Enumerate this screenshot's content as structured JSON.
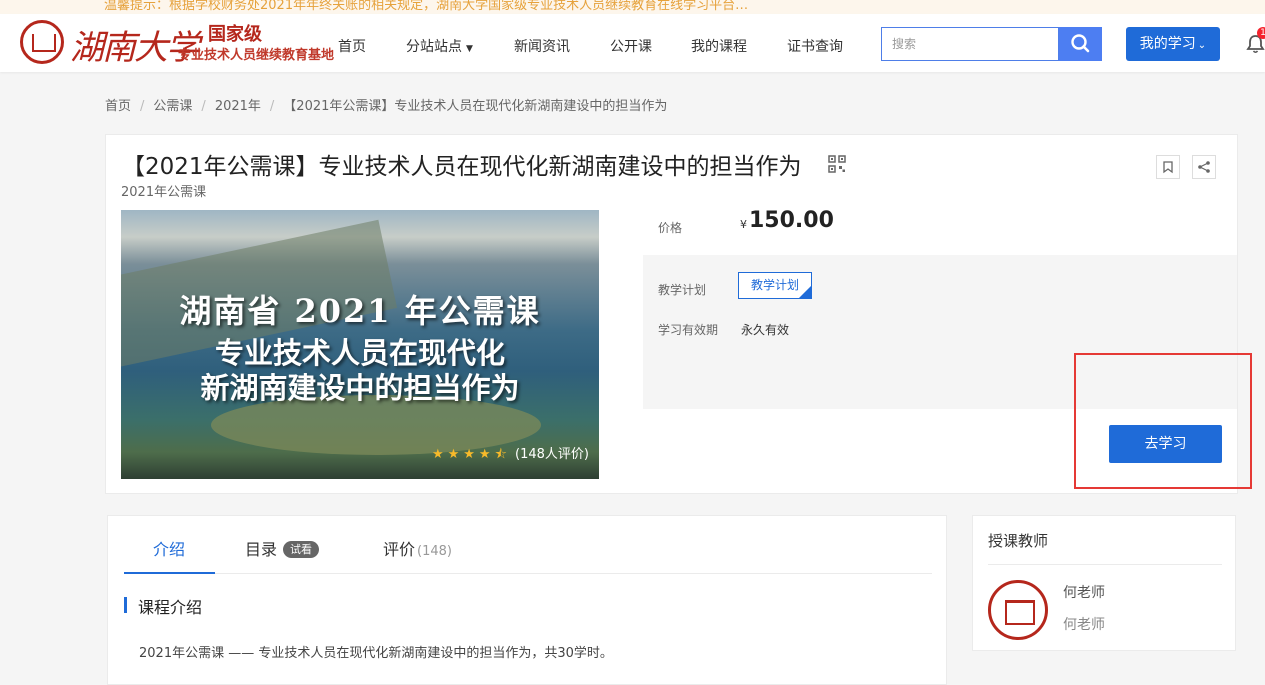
{
  "notice": "温馨提示：根据学校财务处2021年年终关账的相关规定，湖南大学国家级专业技术人员继续教育在线学习平台…",
  "logo": {
    "script": "湖南大学",
    "level": "国家级",
    "subtitle": "专业技术人员继续教育基地"
  },
  "nav": [
    {
      "label": "首页"
    },
    {
      "label": "分站站点",
      "dropdown": true
    },
    {
      "label": "新闻资讯"
    },
    {
      "label": "公开课"
    },
    {
      "label": "我的课程"
    },
    {
      "label": "证书查询"
    }
  ],
  "search": {
    "placeholder": "搜索"
  },
  "header": {
    "my_learning": "我的学习",
    "bell_count": "1"
  },
  "breadcrumb": [
    "首页",
    "公需课",
    "2021年",
    "【2021年公需课】专业技术人员在现代化新湖南建设中的担当作为"
  ],
  "course": {
    "title": "【2021年公需课】专业技术人员在现代化新湖南建设中的担当作为",
    "category": "2021年公需课",
    "cover_lines": [
      "湖南省 2021 年公需课",
      "专业技术人员在现代化",
      "新湖南建设中的担当作为"
    ],
    "rating_stars": 4.5,
    "rating_count": "(148人评价)",
    "price_label": "价格",
    "price_symbol": "¥",
    "price": "150.00",
    "plan_label": "教学计划",
    "plan_button": "教学计划",
    "validity_label": "学习有效期",
    "validity_value": "永久有效",
    "start_button": "去学习"
  },
  "tabs": {
    "intro": "介绍",
    "catalog": "目录",
    "catalog_badge": "试看",
    "reviews": "评价",
    "reviews_count": "(148)"
  },
  "section": {
    "title": "课程介绍",
    "description": "2021年公需课 —— 专业技术人员在现代化新湖南建设中的担当作为，共30学时。"
  },
  "teacher": {
    "heading": "授课教师",
    "name": "何老师",
    "title": "何老师"
  },
  "colors": {
    "primary": "#1f6bd8",
    "brand_red": "#b5271c",
    "highlight_frame": "#e53935",
    "star": "#f7ba2a"
  }
}
